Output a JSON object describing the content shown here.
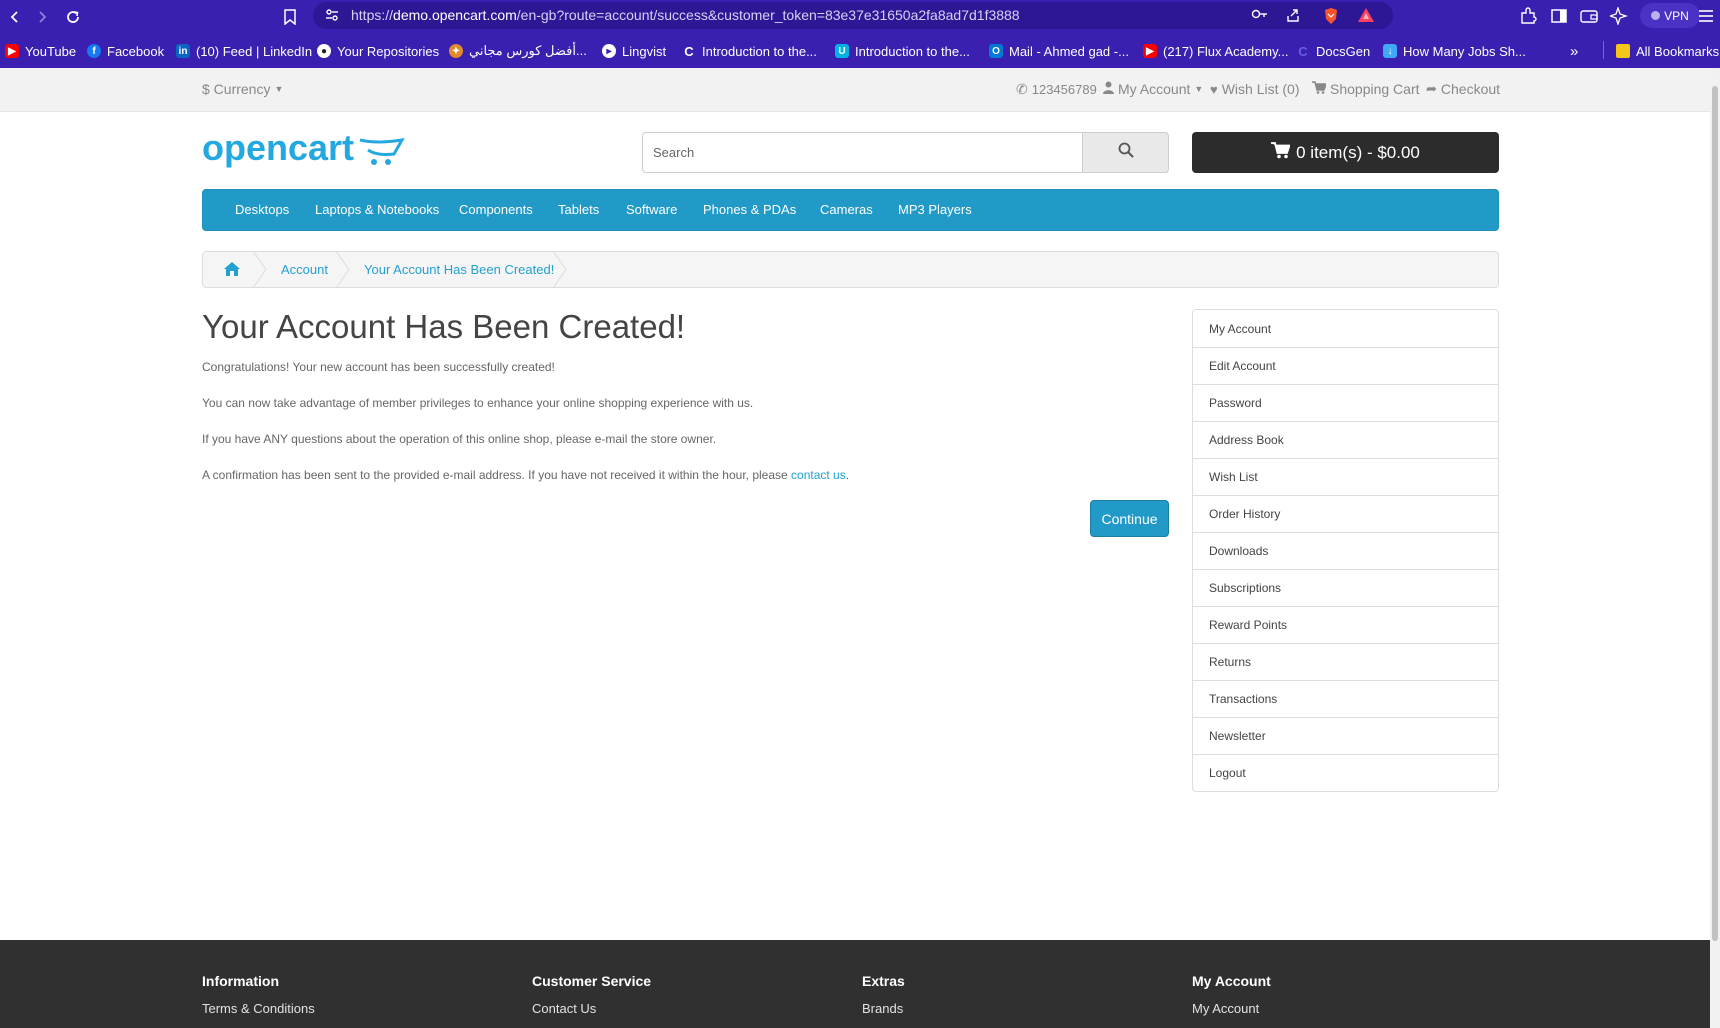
{
  "browser": {
    "url_prefix": "https://",
    "url_host": "demo.opencart.com",
    "url_path": "/en-gb?route=account/success&customer_token=83e37e31650a2fa8ad7d1f3888",
    "vpn_label": "VPN",
    "bookmarks": [
      {
        "label": "YouTube",
        "icon": "youtube-icon",
        "color": "#ff0000"
      },
      {
        "label": "Facebook",
        "icon": "facebook-icon",
        "color": "#1877f2"
      },
      {
        "label": "(10) Feed | LinkedIn",
        "icon": "linkedin-icon",
        "color": "#0a66c2"
      },
      {
        "label": "Your Repositories",
        "icon": "github-icon",
        "color": "#ffffff"
      },
      {
        "label": "أفضل كورس مجاني...",
        "icon": "course-icon",
        "color": "#e08a2c"
      },
      {
        "label": "Lingvist",
        "icon": "lingvist-icon",
        "color": "#ffffff"
      },
      {
        "label": "Introduction to the...",
        "icon": "coursera-icon",
        "color": "#0056d2"
      },
      {
        "label": "Introduction to the...",
        "icon": "udacity-icon",
        "color": "#02b3e4"
      },
      {
        "label": "Mail - Ahmed gad -...",
        "icon": "outlook-icon",
        "color": "#0078d4"
      },
      {
        "label": "(217) Flux Academy...",
        "icon": "youtube-icon",
        "color": "#ff0000"
      },
      {
        "label": "DocsGen",
        "icon": "docsgen-icon",
        "color": "#6b5ce7"
      },
      {
        "label": "How Many Jobs Sh...",
        "icon": "bookmark-page-icon",
        "color": "#3fa9f5"
      }
    ],
    "all_bookmarks_label": "All Bookmarks"
  },
  "topbar": {
    "currency": "$ Currency",
    "phone": "123456789",
    "my_account": "My Account",
    "wish_list": "Wish List (0)",
    "shopping_cart": "Shopping Cart",
    "checkout": "Checkout"
  },
  "header": {
    "logo_text": "opencart",
    "search_placeholder": "Search",
    "cart_label": "0 item(s) - $0.00"
  },
  "menu": {
    "items": [
      "Desktops",
      "Laptops & Notebooks",
      "Components",
      "Tablets",
      "Software",
      "Phones & PDAs",
      "Cameras",
      "MP3 Players"
    ]
  },
  "breadcrumb": {
    "items": [
      "Account",
      "Your Account Has Been Created!"
    ]
  },
  "content": {
    "title": "Your Account Has Been Created!",
    "p1": "Congratulations! Your new account has been successfully created!",
    "p2": "You can now take advantage of member privileges to enhance your online shopping experience with us.",
    "p3": "If you have ANY questions about the operation of this online shop, please e-mail the store owner.",
    "p4_text": "A confirmation has been sent to the provided e-mail address. If you have not received it within the hour, please ",
    "p4_link": "contact us",
    "p4_end": ".",
    "continue_label": "Continue"
  },
  "sidebar": {
    "items": [
      "My Account",
      "Edit Account",
      "Password",
      "Address Book",
      "Wish List",
      "Order History",
      "Downloads",
      "Subscriptions",
      "Reward Points",
      "Returns",
      "Transactions",
      "Newsletter",
      "Logout"
    ]
  },
  "footer": {
    "columns": [
      {
        "heading": "Information",
        "link": "Terms & Conditions"
      },
      {
        "heading": "Customer Service",
        "link": "Contact Us"
      },
      {
        "heading": "Extras",
        "link": "Brands"
      },
      {
        "heading": "My Account",
        "link": "My Account"
      }
    ]
  },
  "colors": {
    "browser_chrome": "#3a1fb0",
    "menu_blue": "#229ac8",
    "link_blue": "#23a1d1",
    "cart_dark": "#2c2c2c",
    "footer_dark": "#303030"
  }
}
